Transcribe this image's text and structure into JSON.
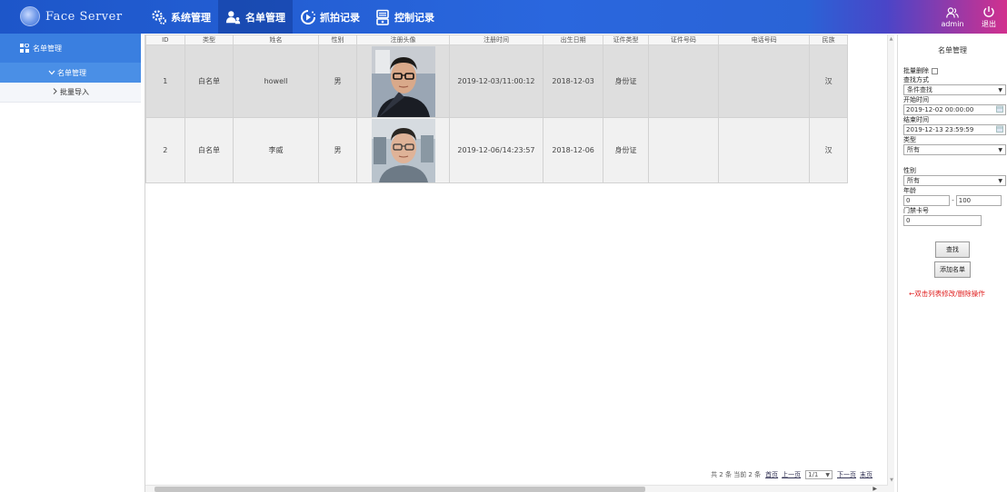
{
  "header": {
    "logo": "Face Server",
    "nav": [
      {
        "label": "系统管理",
        "icon": "gears-icon"
      },
      {
        "label": "名单管理",
        "icon": "users-icon"
      },
      {
        "label": "抓拍记录",
        "icon": "camera-play-icon"
      },
      {
        "label": "控制记录",
        "icon": "monitor-icon"
      }
    ],
    "user": "admin",
    "logout": "退出"
  },
  "sidebar": {
    "section": "名单管理",
    "items": [
      {
        "label": "名单管理",
        "active": true
      },
      {
        "label": "批量导入",
        "active": false
      }
    ]
  },
  "table": {
    "columns": [
      "ID",
      "类型",
      "姓名",
      "性别",
      "注册头像",
      "注册时间",
      "出生日期",
      "证件类型",
      "证件号码",
      "电话号码",
      "民族"
    ],
    "rows": [
      {
        "id": "1",
        "type": "白名单",
        "name": "howell",
        "gender": "男",
        "reg_time": "2019-12-03/11:00:12",
        "birth": "2018-12-03",
        "cert_type": "身份证",
        "cert_no": "",
        "phone": "",
        "nation": "汉"
      },
      {
        "id": "2",
        "type": "白名单",
        "name": "李威",
        "gender": "男",
        "reg_time": "2019-12-06/14:23:57",
        "birth": "2018-12-06",
        "cert_type": "身份证",
        "cert_no": "",
        "phone": "",
        "nation": "汉"
      }
    ]
  },
  "pager": {
    "summary": "共 2 条 当前 2 条",
    "first": "首页",
    "prev": "上一页",
    "page": "1/1",
    "next": "下一页",
    "last": "末页"
  },
  "panel": {
    "title": "名单管理",
    "batch_delete": "批量删除",
    "search_mode_label": "查找方式",
    "search_mode": "条件查找",
    "start_label": "开始时间",
    "start_value": "2019-12-02 00:00:00",
    "end_label": "结束时间",
    "end_value": "2019-12-13 23:59:59",
    "type_label": "类型",
    "type_value": "所有",
    "gender_label": "性别",
    "gender_value": "所有",
    "age_label": "年龄",
    "age_min": "0",
    "age_sep": "-",
    "age_max": "100",
    "card_label": "门禁卡号",
    "card_value": "0",
    "search_button": "查找",
    "add_button": "添加名单",
    "hint": "←双击列表修改/删除操作"
  },
  "colors": {
    "header_blue": "#2a67de",
    "sidebar_active": "#3a7fe0",
    "hint_red": "#e02020"
  }
}
